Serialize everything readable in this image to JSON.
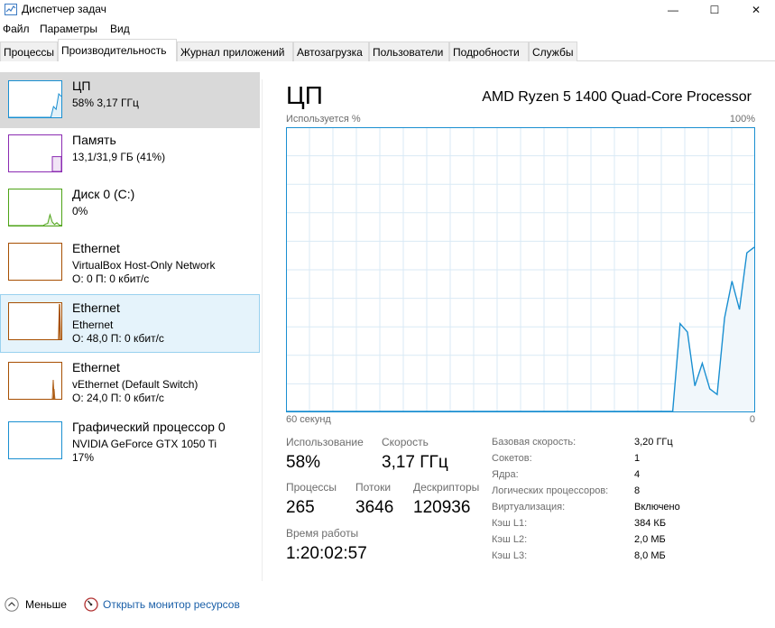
{
  "window": {
    "title": "Диспетчер задач",
    "minimize_glyph": "—",
    "maximize_glyph": "☐",
    "close_glyph": "✕"
  },
  "menu": [
    "Файл",
    "Параметры",
    "Вид"
  ],
  "tabs": [
    {
      "label": "Процессы",
      "active": false
    },
    {
      "label": "Производительность",
      "active": true
    },
    {
      "label": "Журнал приложений",
      "active": false
    },
    {
      "label": "Автозагрузка",
      "active": false
    },
    {
      "label": "Пользователи",
      "active": false
    },
    {
      "label": "Подробности",
      "active": false
    },
    {
      "label": "Службы",
      "active": false
    }
  ],
  "colors": {
    "cpu": "#1a8fd1",
    "memory": "#8b2bb2",
    "disk": "#4da316",
    "ethernet": "#a74f01",
    "gpu": "#1a8fd1",
    "graph_grid": "#d9eaf5",
    "graph_fill": "#f1f7fb",
    "link": "#1a5fa8"
  },
  "sidebar": {
    "cpu": {
      "title": "ЦП",
      "line1": "58% 3,17 ГГц",
      "usage": [
        0,
        0,
        0,
        0,
        0,
        0,
        0,
        0,
        0,
        0,
        0,
        0,
        0,
        0,
        0,
        0,
        0,
        30,
        22,
        65,
        58
      ]
    },
    "memory": {
      "title": "Память",
      "line1": "13,1/31,9 ГБ (41%)",
      "usage": 41
    },
    "disk": {
      "title": "Диск 0 (C:)",
      "line1": "0%",
      "usage": [
        0,
        0,
        0,
        0,
        0,
        0,
        0,
        0,
        0,
        0,
        0,
        0,
        0,
        0,
        0,
        0,
        4,
        6,
        30,
        10,
        3,
        8,
        2,
        0
      ]
    },
    "eth1": {
      "title": "Ethernet",
      "line1": "VirtualBox Host-Only Network",
      "line2": "О: 0 П: 0 кбит/с"
    },
    "eth2": {
      "title": "Ethernet",
      "line1": "Ethernet",
      "line2": "О: 48,0 П: 0 кбит/с"
    },
    "eth3": {
      "title": "Ethernet",
      "line1": "vEthernet (Default Switch)",
      "line2": "О: 24,0 П: 0 кбит/с"
    },
    "gpu": {
      "title": "Графический процессор 0",
      "line1": "NVIDIA GeForce GTX 1050 Ti",
      "line2": "17%"
    }
  },
  "main": {
    "title": "ЦП",
    "processor": "AMD Ryzen 5 1400 Quad-Core Processor",
    "graph_label_left": "Используется %",
    "graph_label_right": "100%",
    "graph_bottom_left": "60 секунд",
    "graph_bottom_right": "0",
    "cpu_history": [
      [
        0,
        0
      ],
      [
        1,
        0
      ],
      [
        2,
        0
      ],
      [
        3,
        0
      ],
      [
        4,
        0
      ],
      [
        5,
        0
      ],
      [
        6,
        0
      ],
      [
        7,
        0
      ],
      [
        8,
        0
      ],
      [
        9,
        0
      ],
      [
        10,
        0
      ],
      [
        11,
        0
      ],
      [
        12,
        0
      ],
      [
        13,
        0
      ],
      [
        14,
        0
      ],
      [
        15,
        0
      ],
      [
        16,
        0
      ],
      [
        17,
        0
      ],
      [
        18,
        0
      ],
      [
        19,
        0
      ],
      [
        20,
        0
      ],
      [
        21,
        0
      ],
      [
        22,
        0
      ],
      [
        23,
        0
      ],
      [
        24,
        0
      ],
      [
        25,
        0
      ],
      [
        26,
        0
      ],
      [
        27,
        0
      ],
      [
        28,
        0
      ],
      [
        29,
        0
      ],
      [
        30,
        0
      ],
      [
        31,
        0
      ],
      [
        32,
        0
      ],
      [
        33,
        0
      ],
      [
        34,
        0
      ],
      [
        35,
        0
      ],
      [
        36,
        0
      ],
      [
        37,
        0
      ],
      [
        38,
        0
      ],
      [
        39,
        0
      ],
      [
        40,
        0
      ],
      [
        41,
        0
      ],
      [
        42,
        0
      ],
      [
        43,
        0
      ],
      [
        44,
        0
      ],
      [
        45,
        0
      ],
      [
        46,
        0
      ],
      [
        47,
        0
      ],
      [
        48,
        0
      ],
      [
        49,
        0
      ],
      [
        50,
        0
      ],
      [
        51,
        0
      ],
      [
        52,
        0
      ],
      [
        53,
        31
      ],
      [
        54,
        28
      ],
      [
        55,
        9
      ],
      [
        56,
        17
      ],
      [
        57,
        8
      ],
      [
        58,
        6
      ],
      [
        59,
        33
      ],
      [
        60,
        46
      ],
      [
        61,
        36
      ],
      [
        62,
        56
      ],
      [
        63,
        58
      ]
    ],
    "stats": {
      "usage_label": "Использование",
      "usage_value": "58%",
      "speed_label": "Скорость",
      "speed_value": "3,17 ГГц",
      "processes_label": "Процессы",
      "processes_value": "265",
      "threads_label": "Потоки",
      "threads_value": "3646",
      "handles_label": "Дескрипторы",
      "handles_value": "120936",
      "uptime_label": "Время работы",
      "uptime_value": "1:20:02:57"
    },
    "specs": [
      {
        "label": "Базовая скорость:",
        "value": "3,20 ГГц"
      },
      {
        "label": "Сокетов:",
        "value": "1"
      },
      {
        "label": "Ядра:",
        "value": "4"
      },
      {
        "label": "Логических процессоров:",
        "value": "8"
      },
      {
        "label": "Виртуализация:",
        "value": "Включено"
      },
      {
        "label": "Кэш L1:",
        "value": "384 КБ"
      },
      {
        "label": "Кэш L2:",
        "value": "2,0 МБ"
      },
      {
        "label": "Кэш L3:",
        "value": "8,0 МБ"
      }
    ]
  },
  "footer": {
    "less_label": "Меньше",
    "monitor_label": "Открыть монитор ресурсов"
  }
}
